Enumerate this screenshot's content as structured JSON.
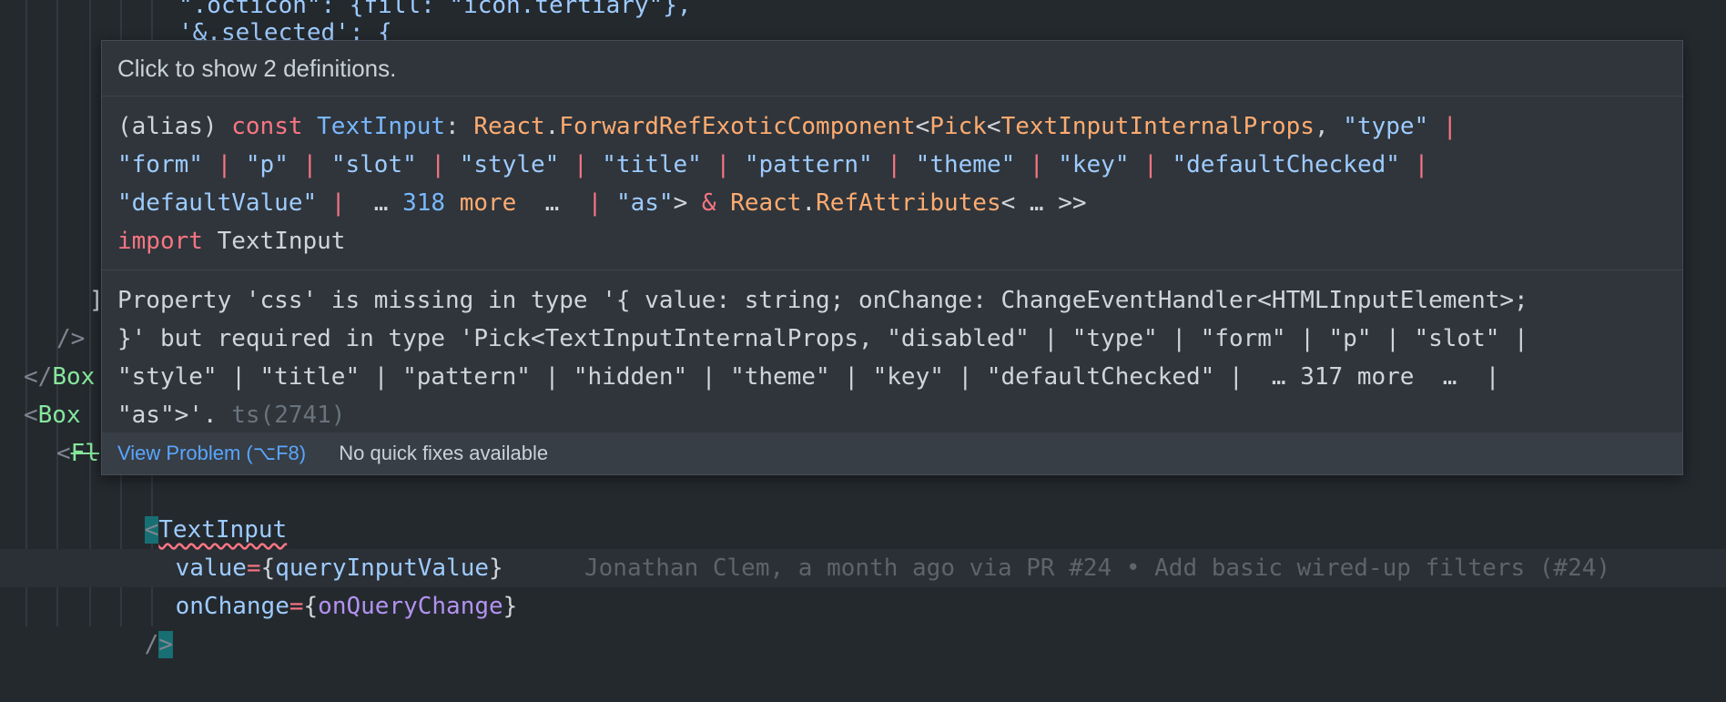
{
  "editor": {
    "lines": [
      {
        "segments": [
          {
            "t": "\".octicon\": {fill: \"icon.tertiary\"},",
            "c": "lightblue"
          }
        ],
        "indent": 196
      },
      {
        "segments": [
          {
            "t": "'&.selected': {",
            "c": "lightblue"
          }
        ],
        "indent": 196
      },
      {
        "segments": [
          {
            "t": "]",
            "c": "grey"
          }
        ],
        "indent": 98
      },
      {
        "segments": [
          {
            "t": "/>",
            "c": "tag"
          }
        ],
        "indent": 62
      },
      {
        "segments": [
          {
            "t": "</",
            "c": "tag"
          },
          {
            "t": "Box",
            "c": "green"
          }
        ],
        "indent": 26
      },
      {
        "segments": [
          {
            "t": "<",
            "c": "tag"
          },
          {
            "t": "Box",
            "c": "green"
          }
        ],
        "indent": 26
      },
      {
        "segments": [
          {
            "t": "<",
            "c": "tag"
          },
          {
            "t": "Fl",
            "c": "green"
          }
        ],
        "indent": 62
      }
    ],
    "textinput_open": "<",
    "textinput_name": "TextInput",
    "prop_value": {
      "name": "value",
      "eq": "=",
      "expr_open": "{",
      "expr": "queryInputValue",
      "expr_close": "}"
    },
    "prop_onchange": {
      "name": "onChange",
      "eq": "=",
      "expr_open": "{",
      "expr": "onQueryChange",
      "expr_close": "}"
    },
    "close_tag": "/>",
    "blame": "Jonathan Clem, a month ago via PR #24 • Add basic wired-up filters (#24)"
  },
  "hover": {
    "header": "Click to show 2 definitions.",
    "signature_rows": [
      [
        {
          "t": "(alias) ",
          "c": "grey"
        },
        {
          "t": "const ",
          "c": "red"
        },
        {
          "t": "TextInput",
          "c": "blue"
        },
        {
          "t": ": ",
          "c": "grey"
        },
        {
          "t": "React",
          "c": "orange"
        },
        {
          "t": ".",
          "c": "grey"
        },
        {
          "t": "ForwardRefExoticComponent",
          "c": "orange"
        },
        {
          "t": "<",
          "c": "grey"
        },
        {
          "t": "Pick",
          "c": "orange"
        },
        {
          "t": "<",
          "c": "grey"
        },
        {
          "t": "TextInputInternalProps",
          "c": "orange"
        },
        {
          "t": ", ",
          "c": "grey"
        },
        {
          "t": "\"type\"",
          "c": "lightblue"
        },
        {
          "t": " |",
          "c": "red"
        }
      ],
      [
        {
          "t": "\"form\"",
          "c": "lightblue"
        },
        {
          "t": " | ",
          "c": "red"
        },
        {
          "t": "\"p\"",
          "c": "lightblue"
        },
        {
          "t": " | ",
          "c": "red"
        },
        {
          "t": "\"slot\"",
          "c": "lightblue"
        },
        {
          "t": " | ",
          "c": "red"
        },
        {
          "t": "\"style\"",
          "c": "lightblue"
        },
        {
          "t": " | ",
          "c": "red"
        },
        {
          "t": "\"title\"",
          "c": "lightblue"
        },
        {
          "t": " | ",
          "c": "red"
        },
        {
          "t": "\"pattern\"",
          "c": "lightblue"
        },
        {
          "t": " | ",
          "c": "red"
        },
        {
          "t": "\"theme\"",
          "c": "lightblue"
        },
        {
          "t": " | ",
          "c": "red"
        },
        {
          "t": "\"key\"",
          "c": "lightblue"
        },
        {
          "t": " | ",
          "c": "red"
        },
        {
          "t": "\"defaultChecked\"",
          "c": "lightblue"
        },
        {
          "t": " |",
          "c": "red"
        }
      ],
      [
        {
          "t": "\"defaultValue\"",
          "c": "lightblue"
        },
        {
          "t": " | ",
          "c": "red"
        },
        {
          "t": " … ",
          "c": "grey"
        },
        {
          "t": "318",
          "c": "blue"
        },
        {
          "t": " more",
          "c": "orange"
        },
        {
          "t": "  … ",
          "c": "grey"
        },
        {
          "t": " | ",
          "c": "red"
        },
        {
          "t": "\"as\"",
          "c": "lightblue"
        },
        {
          "t": "> ",
          "c": "grey"
        },
        {
          "t": "& ",
          "c": "red"
        },
        {
          "t": "React",
          "c": "orange"
        },
        {
          "t": ".",
          "c": "grey"
        },
        {
          "t": "RefAttributes",
          "c": "orange"
        },
        {
          "t": "< … >>",
          "c": "grey"
        }
      ],
      [
        {
          "t": "import ",
          "c": "red"
        },
        {
          "t": "TextInput",
          "c": "grey"
        }
      ]
    ],
    "problem_rows": [
      "Property 'css' is missing in type '{ value: string; onChange: ChangeEventHandler<HTMLInputElement>;",
      "}' but required in type 'Pick<TextInputInternalProps, \"disabled\" | \"type\" | \"form\" | \"p\" | \"slot\" |",
      "\"style\" | \"title\" | \"pattern\" | \"hidden\" | \"theme\" | \"key\" | \"defaultChecked\" |  … 317 more  …  |",
      "\"as\">'."
    ],
    "problem_code": " ts(2741)",
    "view_problem": "View Problem (⌥F8)",
    "no_fixes": "No quick fixes available"
  }
}
